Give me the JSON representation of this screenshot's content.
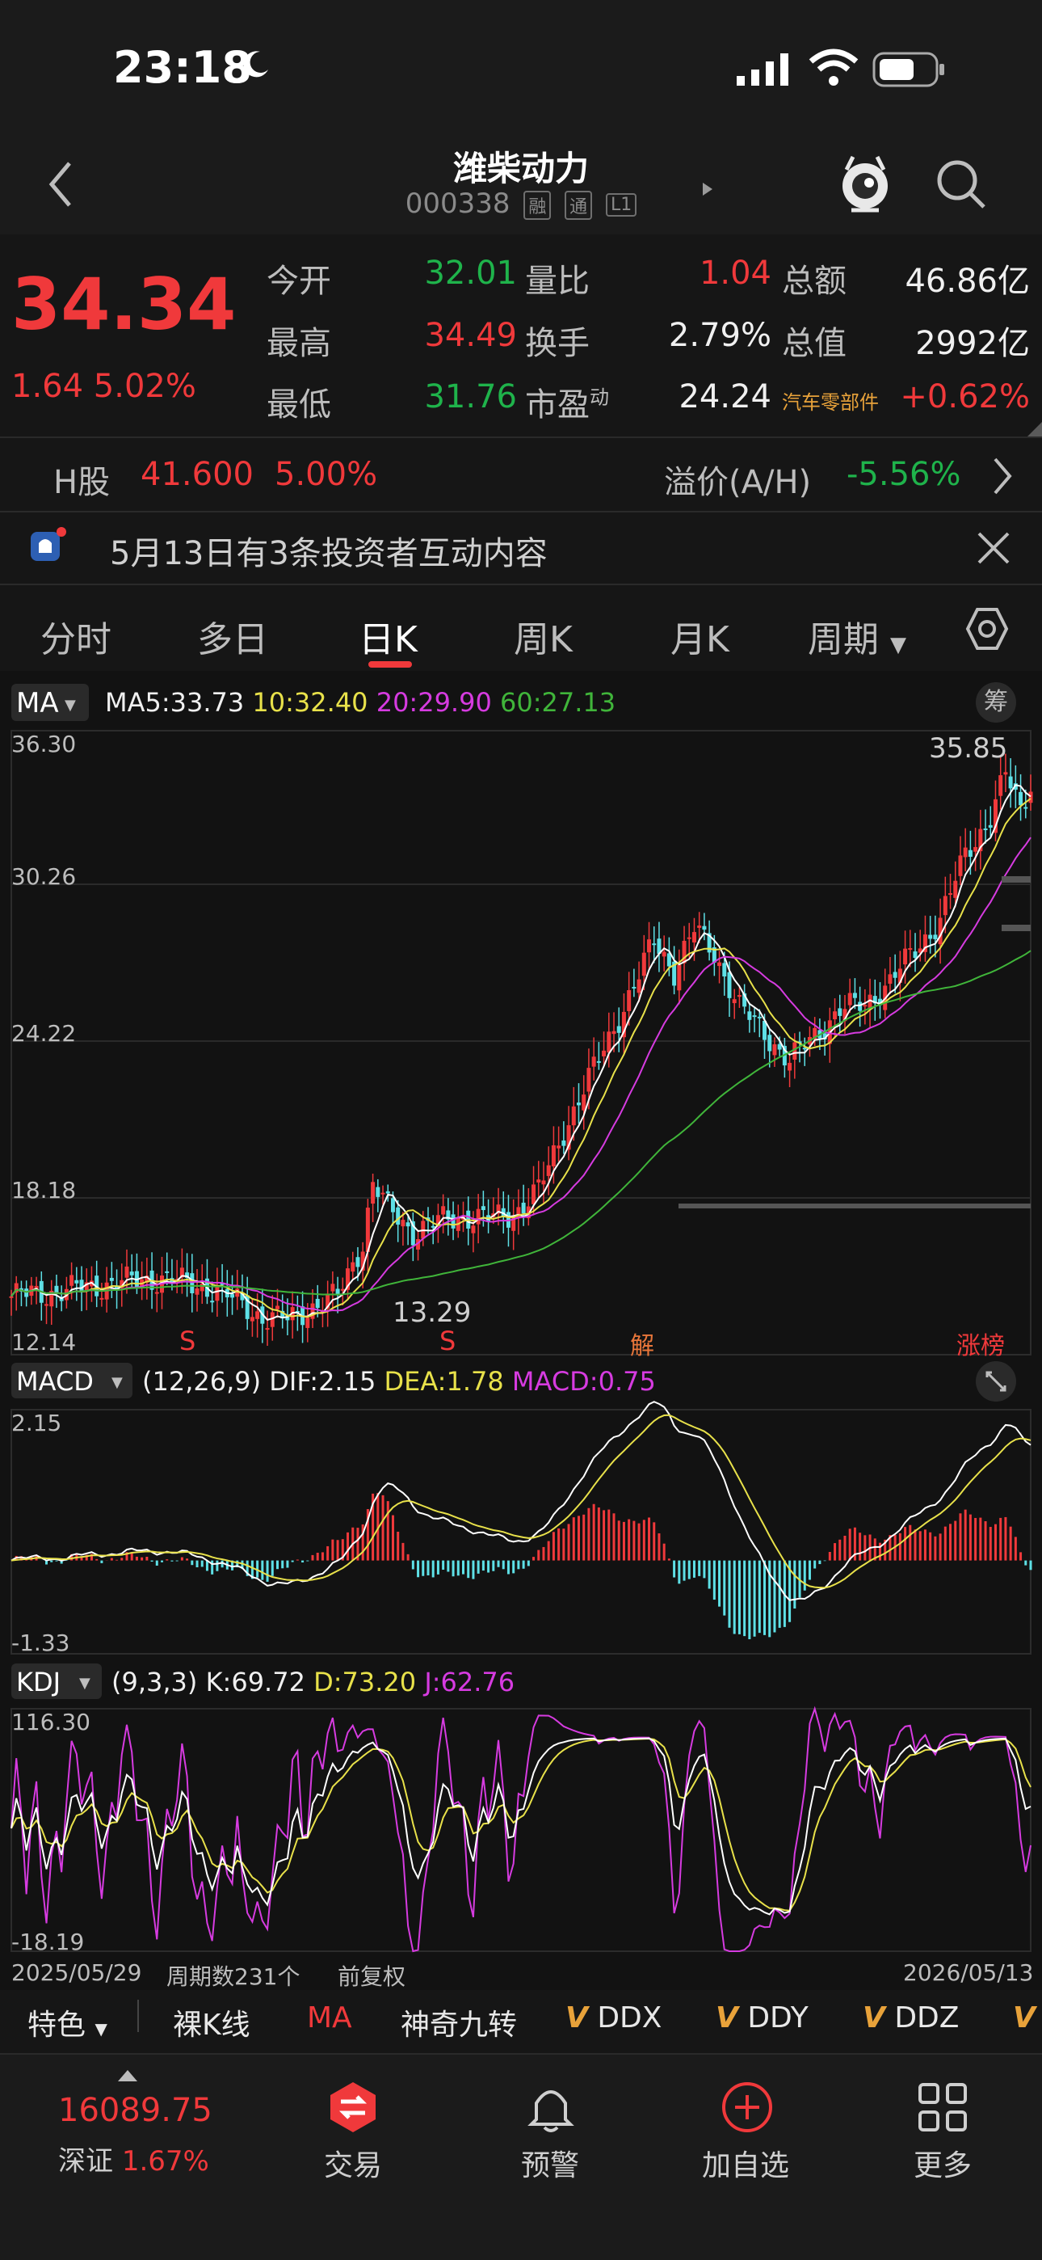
{
  "status_bar": {
    "time": "23:18"
  },
  "header": {
    "title": "潍柴动力",
    "code": "000338",
    "badges": [
      "融",
      "通",
      "L1"
    ]
  },
  "quote": {
    "price": "34.34",
    "change": "1.64",
    "change_pct": "5.02%",
    "rows": [
      {
        "l1": "今开",
        "v1": "32.01",
        "l2": "量比",
        "v2": "1.04",
        "l3": "总额",
        "v3": "46.86亿"
      },
      {
        "l1": "最高",
        "v1": "34.49",
        "l2": "换手",
        "v2": "2.79%",
        "l3": "总值",
        "v3": "2992亿"
      },
      {
        "l1": "最低",
        "v1": "31.76",
        "l2": "市盈",
        "l2sup": "动",
        "v2": "24.24",
        "l3": "汽车零部件",
        "v3": "+0.62%"
      }
    ]
  },
  "hshare": {
    "label": "H股",
    "price": "41.600",
    "pct": "5.00%",
    "premium_label": "溢价(A/H)",
    "premium": "-5.56%"
  },
  "notice": {
    "text": "5月13日有3条投资者互动内容"
  },
  "tabs": [
    "分时",
    "多日",
    "日K",
    "周K",
    "月K",
    "周期"
  ],
  "selected_tab": "日K",
  "ma": {
    "selector": "MA",
    "ma5": "MA5:33.73",
    "ma10": "10:32.40",
    "ma20": "20:29.90",
    "ma60": "60:27.13",
    "chip_button": "筹",
    "y_ticks": [
      "36.30",
      "30.26",
      "24.22",
      "18.18",
      "12.14"
    ],
    "high_label": "35.85",
    "low_label": "13.29",
    "markers": [
      "S",
      "S",
      "解",
      "涨榜"
    ]
  },
  "macd": {
    "selector": "MACD",
    "params": "(12,26,9)",
    "dif": "DIF:2.15",
    "dea": "DEA:1.78",
    "macd": "MACD:0.75",
    "y_ticks": [
      "2.15",
      "-1.33"
    ]
  },
  "kdj": {
    "selector": "KDJ",
    "params": "(9,3,3)",
    "k": "K:69.72",
    "d": "D:73.20",
    "j": "J:62.76",
    "y_ticks": [
      "116.30",
      "-18.19"
    ]
  },
  "footer_info": {
    "start_date": "2025/05/29",
    "period_count": "周期数231个",
    "adjust": "前复权",
    "end_date": "2026/05/13"
  },
  "indicator_bar": {
    "items": [
      "特色",
      "裸K线",
      "MA",
      "神奇九转",
      "DDX",
      "DDY",
      "DDZ"
    ]
  },
  "bottom_nav": {
    "index_value": "16089.75",
    "index_name": "深证",
    "index_pct": "1.67%",
    "items": [
      "交易",
      "预警",
      "加自选",
      "更多"
    ]
  },
  "colors": {
    "up": "#f0393b",
    "down": "#5ee0e6",
    "ma5": "#ffffff",
    "ma10": "#e8e14a",
    "ma20": "#d63be0",
    "ma60": "#40b53a"
  },
  "chart_data": [
    {
      "type": "candlestick",
      "title": "",
      "x_range": [
        "2025/05/29",
        "2026/05/13"
      ],
      "ylim": [
        12.14,
        36.3
      ],
      "series": [
        {
          "name": "MA5",
          "last": 33.73
        },
        {
          "name": "10",
          "last": 32.4
        },
        {
          "name": "20",
          "last": 29.9
        },
        {
          "name": "60",
          "last": 27.13
        }
      ],
      "close_path": [
        [
          0,
          14.4
        ],
        [
          10,
          14.6
        ],
        [
          20,
          14.9
        ],
        [
          30,
          15.1
        ],
        [
          40,
          14.7
        ],
        [
          45,
          14.2
        ],
        [
          50,
          13.6
        ],
        [
          55,
          13.5
        ],
        [
          60,
          14.0
        ],
        [
          65,
          14.4
        ],
        [
          70,
          16.5
        ],
        [
          72,
          18.8
        ],
        [
          75,
          17.8
        ],
        [
          80,
          16.9
        ],
        [
          85,
          17.3
        ],
        [
          90,
          17.5
        ],
        [
          95,
          17.4
        ],
        [
          100,
          17.6
        ],
        [
          105,
          18.5
        ],
        [
          110,
          20.8
        ],
        [
          115,
          22.8
        ],
        [
          120,
          24.8
        ],
        [
          125,
          26.8
        ],
        [
          128,
          28.2
        ],
        [
          132,
          27.0
        ],
        [
          136,
          28.6
        ],
        [
          140,
          27.7
        ],
        [
          145,
          25.6
        ],
        [
          150,
          24.6
        ],
        [
          155,
          23.5
        ],
        [
          160,
          24.5
        ],
        [
          165,
          25.5
        ],
        [
          170,
          25.7
        ],
        [
          175,
          26.6
        ],
        [
          180,
          27.8
        ],
        [
          185,
          29.0
        ],
        [
          190,
          31.5
        ],
        [
          195,
          33.0
        ],
        [
          198,
          34.6
        ],
        [
          201,
          33.2
        ],
        [
          203,
          34.34
        ]
      ]
    },
    {
      "type": "bar",
      "title": "MACD",
      "ylim": [
        -1.33,
        2.15
      ],
      "series": [
        {
          "name": "DIF",
          "last": 2.15
        },
        {
          "name": "DEA",
          "last": 1.78
        },
        {
          "name": "MACD",
          "last": 0.75
        }
      ]
    },
    {
      "type": "line",
      "title": "KDJ",
      "ylim": [
        -18.19,
        116.3
      ],
      "series": [
        {
          "name": "K",
          "last": 69.72
        },
        {
          "name": "D",
          "last": 73.2
        },
        {
          "name": "J",
          "last": 62.76
        }
      ]
    }
  ]
}
